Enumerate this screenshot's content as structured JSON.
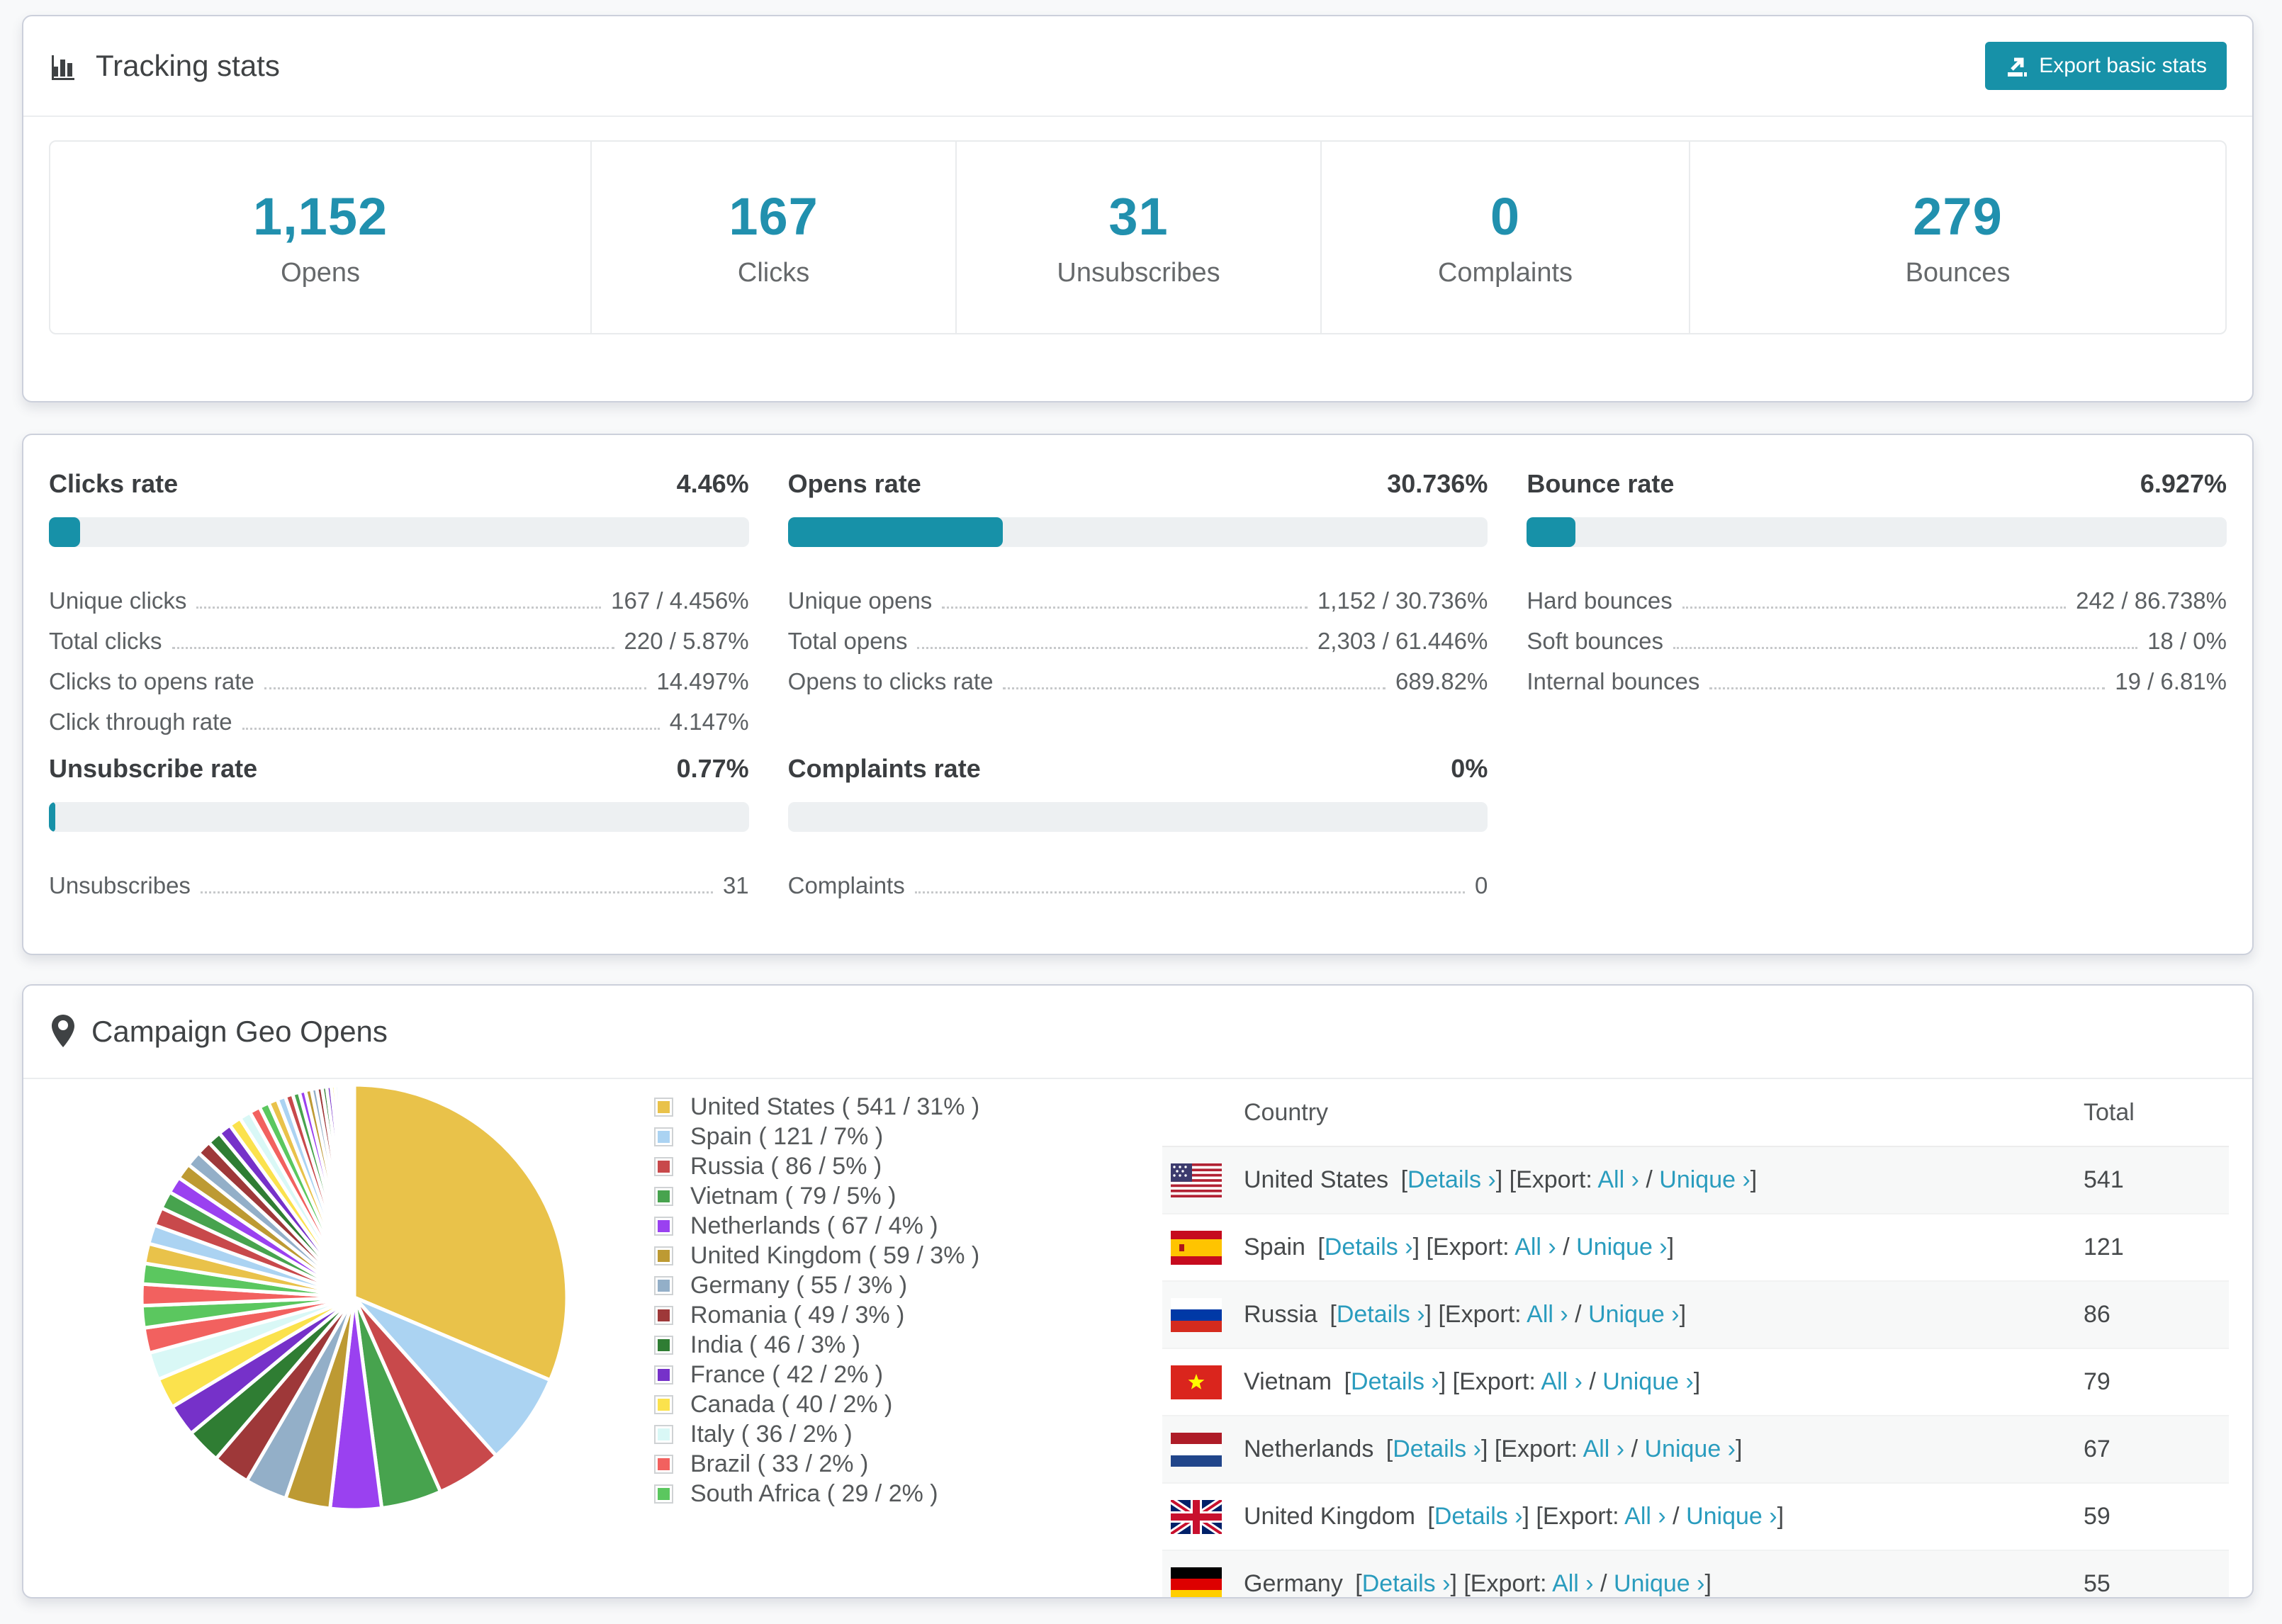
{
  "colors": {
    "accent_teal": "#1791a8",
    "stat_number": "#2190ae",
    "link": "#2a9cbe",
    "progress_track": "#edf0f2",
    "card_border": "#ccd0db",
    "page_background": "#f8f9fa"
  },
  "tracking": {
    "title": "Tracking stats",
    "export_button": "Export basic stats",
    "stats": [
      {
        "value": "1,152",
        "label": "Opens"
      },
      {
        "value": "167",
        "label": "Clicks"
      },
      {
        "value": "31",
        "label": "Unsubscribes"
      },
      {
        "value": "0",
        "label": "Complaints"
      },
      {
        "value": "279",
        "label": "Bounces"
      }
    ]
  },
  "rates": {
    "sections": [
      {
        "key": "clicks",
        "title": "Clicks rate",
        "value": "4.46%",
        "progress": 4.46,
        "rows": [
          {
            "label": "Unique clicks",
            "value": "167 / 4.456%"
          },
          {
            "label": "Total clicks",
            "value": "220 / 5.87%"
          },
          {
            "label": "Clicks to opens rate",
            "value": "14.497%"
          },
          {
            "label": "Click through rate",
            "value": "4.147%"
          }
        ]
      },
      {
        "key": "opens",
        "title": "Opens rate",
        "value": "30.736%",
        "progress": 30.736,
        "rows": [
          {
            "label": "Unique opens",
            "value": "1,152 / 30.736%"
          },
          {
            "label": "Total opens",
            "value": "2,303 / 61.446%"
          },
          {
            "label": "Opens to clicks rate",
            "value": "689.82%"
          }
        ]
      },
      {
        "key": "bounce",
        "title": "Bounce rate",
        "value": "6.927%",
        "progress": 6.927,
        "rows": [
          {
            "label": "Hard bounces",
            "value": "242 / 86.738%"
          },
          {
            "label": "Soft bounces",
            "value": "18 / 0%"
          },
          {
            "label": "Internal bounces",
            "value": "19 / 6.81%"
          }
        ]
      },
      {
        "key": "unsubscribe",
        "title": "Unsubscribe rate",
        "value": "0.77%",
        "progress": 0.77,
        "rows": [
          {
            "label": "Unsubscribes",
            "value": "31"
          }
        ]
      },
      {
        "key": "complaints",
        "title": "Complaints rate",
        "value": "0%",
        "progress": 0,
        "rows": [
          {
            "label": "Complaints",
            "value": "0"
          }
        ]
      }
    ]
  },
  "geo": {
    "title": "Campaign Geo Opens",
    "legend": [
      {
        "label": "United States ( 541 / 31% )",
        "color": "#e9c24a"
      },
      {
        "label": "Spain ( 121 / 7% )",
        "color": "#abd3f2"
      },
      {
        "label": "Russia ( 86 / 5% )",
        "color": "#c8494b"
      },
      {
        "label": "Vietnam ( 79 / 5% )",
        "color": "#47a34e"
      },
      {
        "label": "Netherlands ( 67 / 4% )",
        "color": "#9a41f0"
      },
      {
        "label": "United Kingdom ( 59 / 3% )",
        "color": "#bd9a33"
      },
      {
        "label": "Germany ( 55 / 3% )",
        "color": "#93afc8"
      },
      {
        "label": "Romania ( 49 / 3% )",
        "color": "#9e3839"
      },
      {
        "label": "India ( 46 / 3% )",
        "color": "#2f7d33"
      },
      {
        "label": "France ( 42 / 2% )",
        "color": "#7631c9"
      },
      {
        "label": "Canada ( 40 / 2% )",
        "color": "#fbe24d"
      },
      {
        "label": "Italy ( 36 / 2% )",
        "color": "#d9f8f6"
      },
      {
        "label": "Brazil ( 33 / 2% )",
        "color": "#f2615f"
      },
      {
        "label": "South Africa ( 29 / 2% )",
        "color": "#5bc75f"
      }
    ],
    "table": {
      "columns": [
        "Country",
        "Total"
      ],
      "link_details": "Details ›",
      "link_all": "All ›",
      "link_unique": "Unique ›",
      "glue_open_details": "[",
      "glue_export": "] [Export: ",
      "glue_slash": " / ",
      "glue_close": "]",
      "rows": [
        {
          "country": "United States",
          "flag": "us",
          "total": "541"
        },
        {
          "country": "Spain",
          "flag": "es",
          "total": "121"
        },
        {
          "country": "Russia",
          "flag": "ru",
          "total": "86"
        },
        {
          "country": "Vietnam",
          "flag": "vn",
          "total": "79"
        },
        {
          "country": "Netherlands",
          "flag": "nl",
          "total": "67"
        },
        {
          "country": "United Kingdom",
          "flag": "gb",
          "total": "59"
        },
        {
          "country": "Germany",
          "flag": "de",
          "total": "55"
        }
      ]
    }
  },
  "chart_data": {
    "type": "pie",
    "title": "Campaign Geo Opens",
    "labels": [
      "United States",
      "Spain",
      "Russia",
      "Vietnam",
      "Netherlands",
      "United Kingdom",
      "Germany",
      "Romania",
      "India",
      "France",
      "Canada",
      "Italy",
      "Brazil",
      "South Africa"
    ],
    "values": [
      541,
      121,
      86,
      79,
      67,
      59,
      55,
      49,
      46,
      42,
      40,
      36,
      33,
      29
    ],
    "percent_labels": [
      "31%",
      "7%",
      "5%",
      "5%",
      "4%",
      "3%",
      "3%",
      "3%",
      "3%",
      "2%",
      "2%",
      "2%",
      "2%",
      "2%"
    ],
    "colors": [
      "#e9c24a",
      "#abd3f2",
      "#c8494b",
      "#47a34e",
      "#9a41f0",
      "#bd9a33",
      "#93afc8",
      "#9e3839",
      "#2f7d33",
      "#7631c9",
      "#fbe24d",
      "#d9f8f6",
      "#f2615f",
      "#5bc75f"
    ],
    "unlabeled_small_slice_values": [
      28,
      27,
      26,
      25,
      24,
      23,
      22,
      21,
      20,
      19,
      18,
      17,
      16,
      15,
      14,
      13,
      12,
      11,
      10,
      9,
      8,
      8,
      7,
      7,
      6,
      6,
      5,
      5,
      4,
      4,
      3,
      3,
      2,
      2,
      1,
      1
    ],
    "start_angle_deg": -90,
    "direction": "clockwise",
    "legend_position": "right",
    "donut": false,
    "slice_border_color": "#ffffff"
  }
}
